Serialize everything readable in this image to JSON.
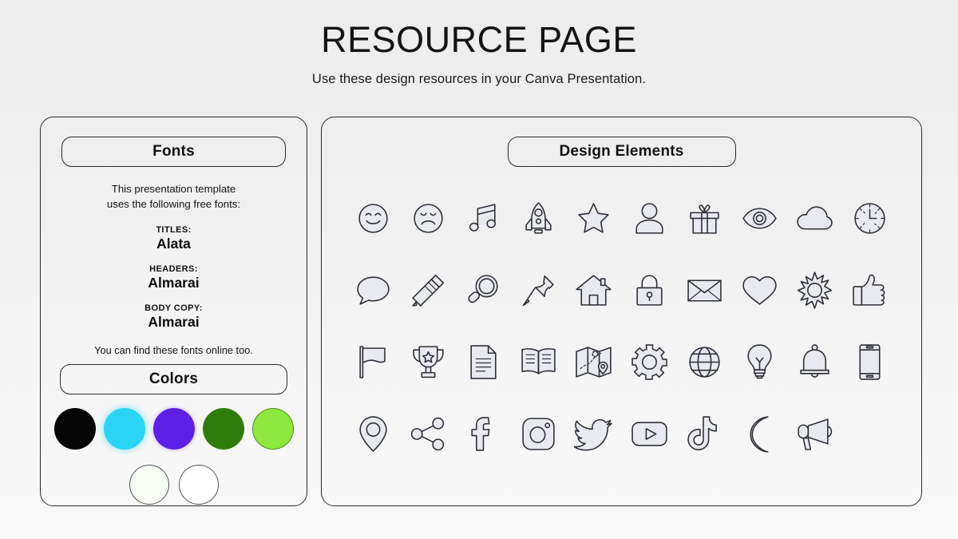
{
  "header": {
    "title": "RESOURCE PAGE",
    "subtitle": "Use these design resources in your Canva Presentation."
  },
  "fonts_panel": {
    "header_label": "Fonts",
    "intro_line1": "This presentation template",
    "intro_line2": "uses the following free fonts:",
    "entries": [
      {
        "label": "TITLES:",
        "value": "Alata"
      },
      {
        "label": "HEADERS:",
        "value": "Almarai"
      },
      {
        "label": "BODY COPY:",
        "value": "Almarai"
      }
    ],
    "outro": "You can find these fonts online too."
  },
  "colors_panel": {
    "header_label": "Colors",
    "main_swatches": [
      {
        "name": "black",
        "hex": "#050505"
      },
      {
        "name": "cyan",
        "hex": "#29D4F5"
      },
      {
        "name": "purple",
        "hex": "#5C1FE8"
      },
      {
        "name": "dark-green",
        "hex": "#2E7D0A"
      },
      {
        "name": "light-green",
        "hex": "#8CE83C"
      }
    ],
    "neutral_swatches": [
      {
        "name": "off-white",
        "hex": "#F6FBF4"
      },
      {
        "name": "white",
        "hex": "#FFFFFF"
      }
    ]
  },
  "elements_panel": {
    "header_label": "Design Elements",
    "icons": [
      {
        "name": "smiley-face-icon",
        "row": 1,
        "col": 1
      },
      {
        "name": "sad-face-icon",
        "row": 1,
        "col": 2
      },
      {
        "name": "music-note-icon",
        "row": 1,
        "col": 3
      },
      {
        "name": "rocket-icon",
        "row": 1,
        "col": 4
      },
      {
        "name": "star-icon",
        "row": 1,
        "col": 5
      },
      {
        "name": "person-icon",
        "row": 1,
        "col": 6
      },
      {
        "name": "gift-icon",
        "row": 1,
        "col": 7
      },
      {
        "name": "eye-icon",
        "row": 1,
        "col": 8
      },
      {
        "name": "cloud-icon",
        "row": 1,
        "col": 9
      },
      {
        "name": "clock-icon",
        "row": 1,
        "col": 10
      },
      {
        "name": "speech-bubble-icon",
        "row": 2,
        "col": 1
      },
      {
        "name": "pencil-icon",
        "row": 2,
        "col": 2
      },
      {
        "name": "magnifying-glass-icon",
        "row": 2,
        "col": 3
      },
      {
        "name": "pushpin-icon",
        "row": 2,
        "col": 4
      },
      {
        "name": "house-icon",
        "row": 2,
        "col": 5
      },
      {
        "name": "lock-icon",
        "row": 2,
        "col": 6
      },
      {
        "name": "envelope-icon",
        "row": 2,
        "col": 7
      },
      {
        "name": "heart-icon",
        "row": 2,
        "col": 8
      },
      {
        "name": "sun-icon",
        "row": 2,
        "col": 9
      },
      {
        "name": "thumbs-up-icon",
        "row": 3,
        "col": 1
      },
      {
        "name": "flag-icon",
        "row": 3,
        "col": 2
      },
      {
        "name": "trophy-icon",
        "row": 3,
        "col": 3
      },
      {
        "name": "document-icon",
        "row": 3,
        "col": 4
      },
      {
        "name": "book-icon",
        "row": 3,
        "col": 5
      },
      {
        "name": "map-icon",
        "row": 3,
        "col": 6
      },
      {
        "name": "gear-icon",
        "row": 3,
        "col": 7
      },
      {
        "name": "globe-icon",
        "row": 3,
        "col": 8
      },
      {
        "name": "lightbulb-icon",
        "row": 3,
        "col": 9
      },
      {
        "name": "bell-icon",
        "row": 3,
        "col": 10
      },
      {
        "name": "phone-icon",
        "row": 4,
        "col": 1
      },
      {
        "name": "location-pin-icon",
        "row": 4,
        "col": 2
      },
      {
        "name": "share-icon",
        "row": 4,
        "col": 3
      },
      {
        "name": "facebook-icon",
        "row": 4,
        "col": 4
      },
      {
        "name": "instagram-icon",
        "row": 4,
        "col": 5
      },
      {
        "name": "twitter-icon",
        "row": 4,
        "col": 6
      },
      {
        "name": "youtube-icon",
        "row": 4,
        "col": 7
      },
      {
        "name": "tiktok-icon",
        "row": 4,
        "col": 8
      },
      {
        "name": "moon-icon",
        "row": 4,
        "col": 9
      },
      {
        "name": "megaphone-icon",
        "row": 4,
        "col": 10
      }
    ]
  }
}
